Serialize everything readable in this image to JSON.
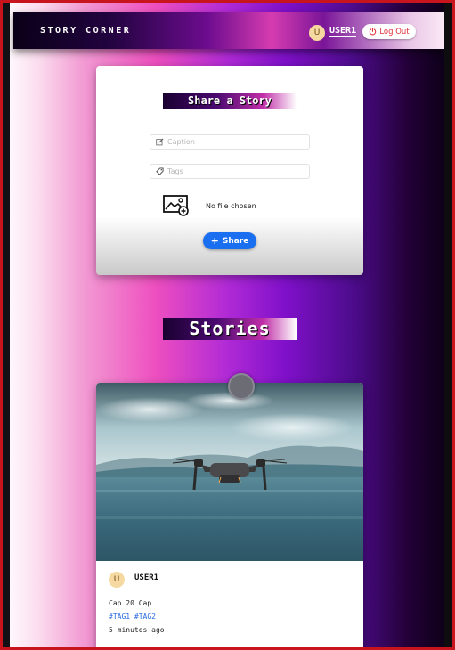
{
  "navbar": {
    "brand": "STORY CORNER",
    "avatar_initial": "U",
    "username": "USER1",
    "logout_label": "Log Out"
  },
  "share_form": {
    "title": "Share a Story",
    "caption_placeholder": "Caption",
    "tags_placeholder": "Tags",
    "file_status": "No file chosen",
    "share_label": "Share"
  },
  "stories_section": {
    "title": "Stories"
  },
  "stories": [
    {
      "avatar_initial": "U",
      "author": "USER1",
      "caption": "Cap 20 Cap",
      "tags": "#TAG1 #TAG2",
      "time": "5 minutes ago",
      "image_subject": "drone flying over water"
    }
  ],
  "colors": {
    "accent_button": "#1a6ff0",
    "logout_text": "#e0303a",
    "tag_link": "#2a6ae0",
    "avatar_bg": "#f6d9a0"
  }
}
